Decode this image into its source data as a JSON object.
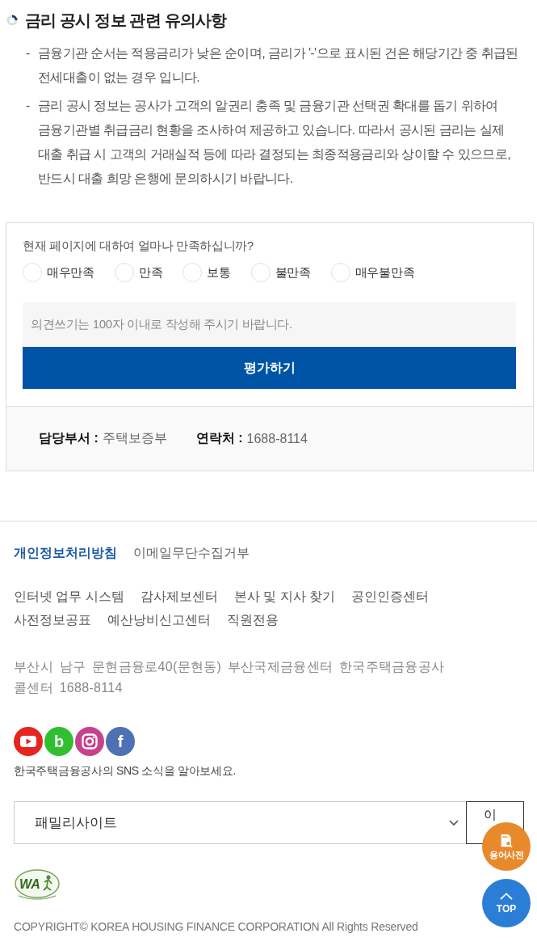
{
  "notice": {
    "title": "금리 공시 정보 관련 유의사항",
    "items": [
      {
        "marker": "-",
        "text": "금융기관 순서는 적용금리가 낮은 순이며, 금리가 '-'으로 표시된 건은 해당기간 중 취급된 전세대출이 없는 경우 입니다."
      },
      {
        "marker": "-",
        "text": "금리 공시 정보는 공사가 고객의 알권리 충족 및 금융기관 선택권 확대를 돕기 위하여 금융기관별 취급금리 현황을 조사하여 제공하고 있습니다. 따라서 공시된 금리는 실제 대출 취급 시 고객의 거래실적 등에 따라 결정되는 최종적용금리와 상이할 수 있으므로, 반드시 대출 희망 은행에 문의하시기 바랍니다."
      }
    ]
  },
  "survey": {
    "question": "현재 페이지에 대하여 얼마나 만족하십니까?",
    "options": [
      {
        "label": "매우만족",
        "selected": false
      },
      {
        "label": "만족",
        "selected": false
      },
      {
        "label": "보통",
        "selected": false
      },
      {
        "label": "불만족",
        "selected": false
      },
      {
        "label": "매우불만족",
        "selected": false
      }
    ],
    "opinion": {
      "placeholder": "의견쓰기는 100자 이내로 작성해 주시기 바랍니다."
    },
    "submit": "평가하기"
  },
  "contacts": [
    {
      "label": "담당부서 :",
      "value": "주택보증부"
    },
    {
      "label": "연락처 :",
      "value": "1688-8114"
    }
  ],
  "footer": {
    "policy_links": [
      {
        "label": "개인정보처리방침",
        "kind": "primary"
      },
      {
        "label": "이메일무단수집거부",
        "kind": "normal"
      }
    ],
    "links": [
      "인터넷 업무 시스템",
      "감사제보센터",
      "본사 및 지사 찾기",
      "공인인증센터",
      "사전정보공표",
      "예산낭비신고센터",
      "직원전용"
    ],
    "address": [
      "부산시 남구 문현금융로40(문현동) 부산국제금융센터 한국주택금융공사",
      "콜센터 1688-8114"
    ],
    "sns": [
      {
        "kind": "play",
        "color": "#e62420"
      },
      {
        "kind": "letter",
        "glyph": "b",
        "color": "#2fbf2f"
      },
      {
        "kind": "camera",
        "color": "#c8418c"
      },
      {
        "kind": "letter",
        "glyph": "f",
        "color": "#4e71b4"
      }
    ],
    "sns_caption": "한국주택금융공사의 SNS 소식을 알아보세요.",
    "family_site": {
      "value": "패밀리사이트",
      "button": "이"
    },
    "accessibility_mark": "WA",
    "copyright": "COPYRIGHT© KOREA HOUSING FINANCE CORPORATION All Rights Reserved"
  },
  "floating": {
    "glossary": "용어사전",
    "top": "TOP"
  }
}
